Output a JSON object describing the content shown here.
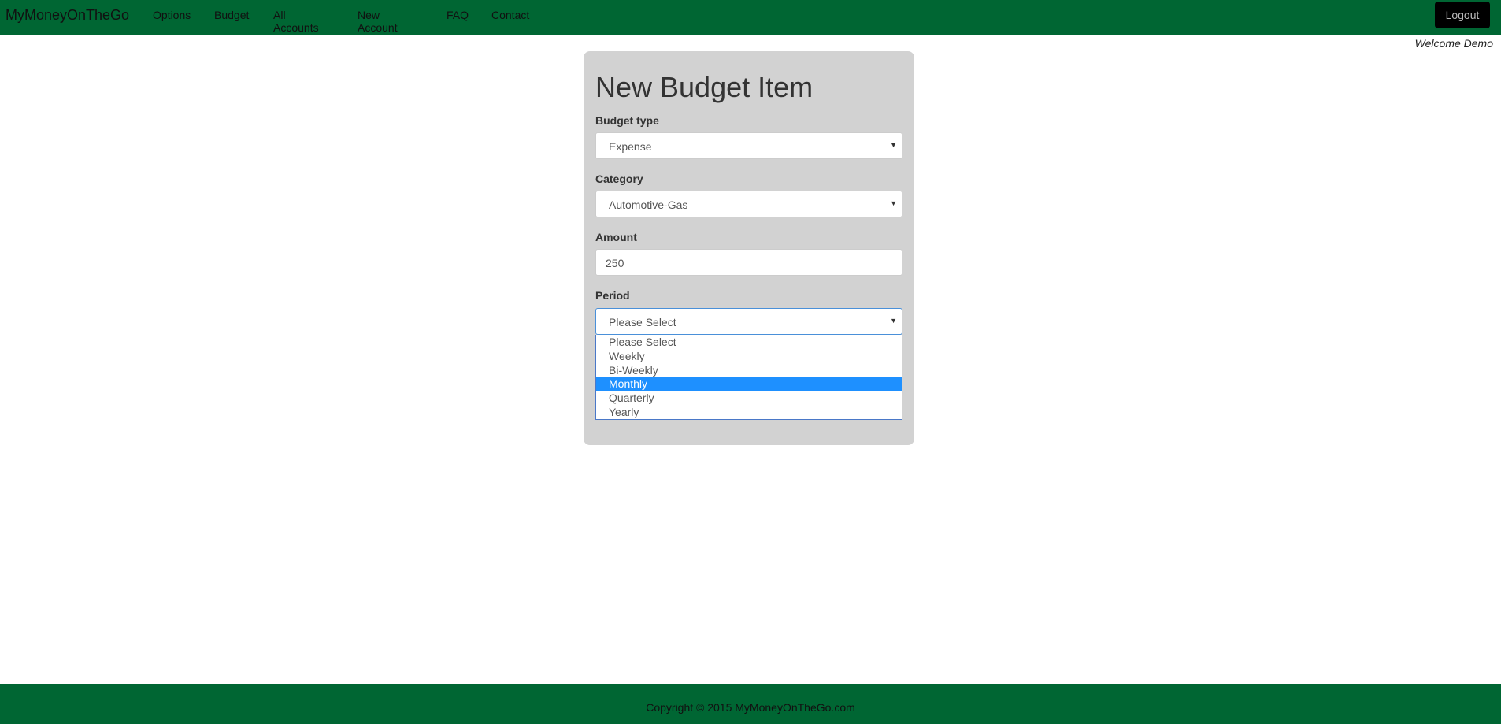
{
  "navbar": {
    "brand": "MyMoneyOnTheGo",
    "links": [
      "Options",
      "Budget",
      "All Accounts",
      "New Account",
      "FAQ",
      "Contact"
    ],
    "logout_label": "Logout",
    "background": "#006633"
  },
  "welcome_text": "Welcome Demo",
  "form": {
    "title": "New Budget Item",
    "budget_type": {
      "label": "Budget type",
      "value": "Expense"
    },
    "category": {
      "label": "Category",
      "value": "Automotive-Gas"
    },
    "amount": {
      "label": "Amount",
      "value": "250"
    },
    "period": {
      "label": "Period",
      "value": "Please Select",
      "options": [
        "Please Select",
        "Weekly",
        "Bi-Weekly",
        "Monthly",
        "Quarterly",
        "Yearly"
      ],
      "highlighted_option": "Monthly"
    }
  },
  "footer": {
    "copyright": "Copyright © 2015 MyMoneyOnTheGo.com"
  },
  "icons": {
    "select_caret": "chevron-down-icon"
  },
  "colors": {
    "accent": "#006633",
    "highlight": "#1e90ff"
  }
}
